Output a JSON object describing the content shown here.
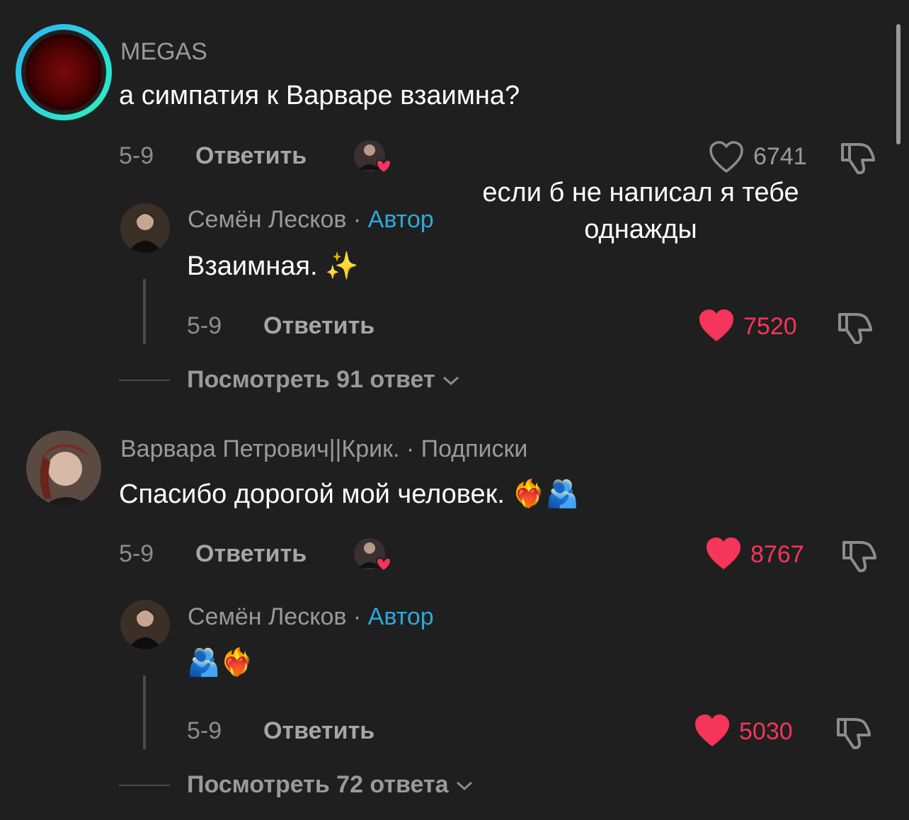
{
  "overlay": {
    "line1": "если б не написал я тебе",
    "line2": "однажды"
  },
  "comments": [
    {
      "username": "MEGAS",
      "text": "а симпатия к Варваре взаимна?",
      "date": "5-9",
      "reply_label": "Ответить",
      "likes": "6741",
      "liked": false,
      "creator_liked": true,
      "reply": {
        "username": "Семён Лесков",
        "separator": "·",
        "tag": "Автор",
        "text": "Взаимная. ✨",
        "date": "5-9",
        "reply_label": "Ответить",
        "likes": "7520",
        "liked": true
      },
      "view_more": "Посмотреть 91 ответ"
    },
    {
      "username": "Варвара Петрович||Крик. · Подписки",
      "text": "Спасибо дорогой мой человек. ❤️‍🔥🫂",
      "date": "5-9",
      "reply_label": "Ответить",
      "likes": "8767",
      "liked": true,
      "creator_liked": true,
      "reply": {
        "username": "Семён Лесков",
        "separator": "·",
        "tag": "Автор",
        "text": "🫂❤️‍🔥",
        "date": "5-9",
        "reply_label": "Ответить",
        "likes": "5030",
        "liked": true
      },
      "view_more": "Посмотреть 72 ответа"
    }
  ],
  "colors": {
    "background": "#1f1f1f",
    "author_tag": "#2ea8d8",
    "like_active": "#f5355a",
    "story_ring_start": "#2bb6f5",
    "story_ring_end": "#2ef0c3"
  },
  "icons": {
    "like": "heart-icon",
    "dislike": "thumbs-down-icon",
    "expand": "chevron-down-icon",
    "creator_liked": "creator-liked-badge"
  }
}
